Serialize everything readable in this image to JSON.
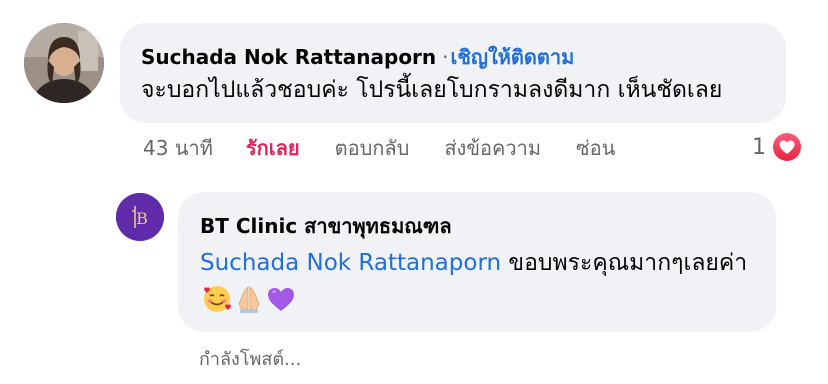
{
  "comment": {
    "author": "Suchada Nok Rattanaporn",
    "separator": "·",
    "follow_label": "เชิญให้ติดตาม",
    "text": "จะบอกไปแล้วชอบค่ะ โปรนี้เลยโบกรามลงดีมาก เห็นชัดเลย",
    "time": "43 นาที",
    "love_label": "รักเลย",
    "reply_label": "ตอบกลับ",
    "message_label": "ส่งข้อความ",
    "hide_label": "ซ่อน",
    "reaction_count": "1",
    "reaction_icon": "heart-icon"
  },
  "reply": {
    "author": "BT Clinic สาขาพุทธมณฑล",
    "mention": "Suchada Nok Rattanaporn",
    "text": " ขอบพระคุณมากๆเลยค่า",
    "emojis": [
      "smiling-face-with-hearts-icon",
      "folded-hands-icon",
      "purple-heart-icon"
    ],
    "avatar_icon": "bt-logo-icon",
    "avatar_letters": "B"
  },
  "status": {
    "posting_label": "กำลังโพสต์..."
  },
  "colors": {
    "link_blue": "#216fdb",
    "love_red": "#e0245e",
    "bubble_bg": "#f0f2f5",
    "muted_text": "#65676b",
    "brand_purple": "#5f2ba8"
  }
}
